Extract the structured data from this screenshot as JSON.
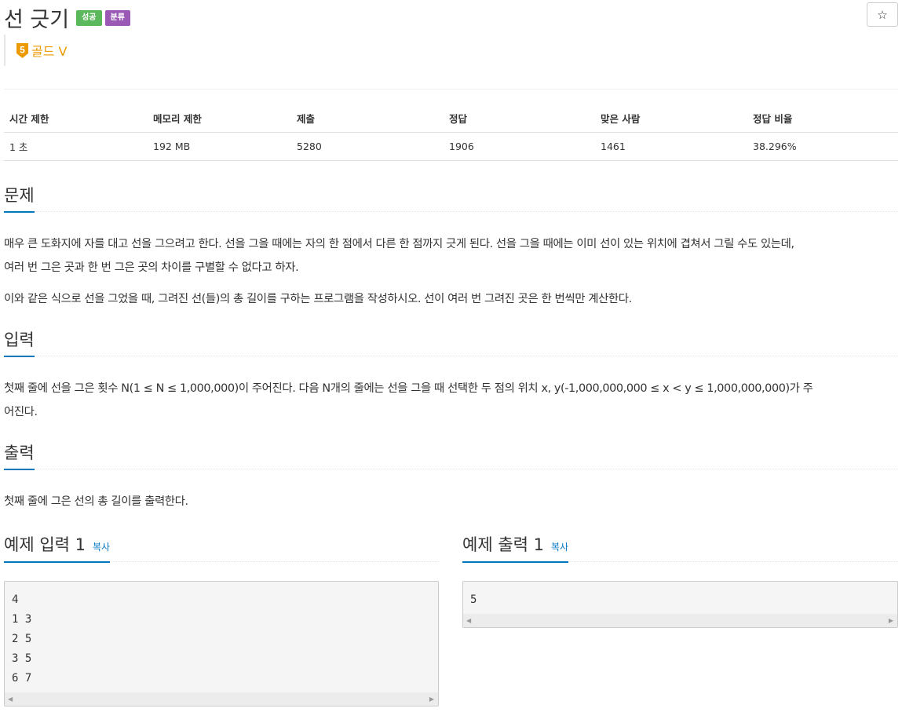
{
  "problem": {
    "title": "선 긋기",
    "badges": {
      "success": "성공",
      "category": "분류"
    },
    "tier": {
      "number": "5",
      "label": "골드 V"
    },
    "star_icon": "☆"
  },
  "info_table": {
    "headers": [
      "시간 제한",
      "메모리 제한",
      "제출",
      "정답",
      "맞은 사람",
      "정답 비율"
    ],
    "values": [
      "1 초",
      "192 MB",
      "5280",
      "1906",
      "1461",
      "38.296%"
    ]
  },
  "sections": {
    "problem": {
      "heading": "문제",
      "paragraphs": [
        "매우 큰 도화지에 자를 대고 선을 그으려고 한다. 선을 그을 때에는 자의 한 점에서 다른 한 점까지 긋게 된다. 선을 그을 때에는 이미 선이 있는 위치에 겹쳐서 그릴 수도 있는데,",
        "여러 번 그은 곳과 한 번 그은 곳의 차이를 구별할 수 없다고 하자.",
        "이와 같은 식으로 선을 그었을 때, 그려진 선(들)의 총 길이를 구하는 프로그램을 작성하시오. 선이 여러 번 그려진 곳은 한 번씩만 계산한다."
      ]
    },
    "input": {
      "heading": "입력",
      "paragraphs": [
        "첫째 줄에 선을 그은 횟수 N(1 ≤ N ≤ 1,000,000)이 주어진다. 다음 N개의 줄에는 선을 그을 때 선택한 두 점의 위치 x, y(-1,000,000,000 ≤ x < y ≤ 1,000,000,000)가 주",
        "어진다."
      ]
    },
    "output": {
      "heading": "출력",
      "paragraphs": [
        "첫째 줄에 그은 선의 총 길이를 출력한다."
      ]
    }
  },
  "samples": {
    "input": {
      "heading": "예제 입력 1",
      "copy": "복사",
      "content": "4\n1 3\n2 5\n3 5\n6 7"
    },
    "output": {
      "heading": "예제 출력 1",
      "copy": "복사",
      "content": "5"
    }
  },
  "colors": {
    "success": "#5cb85c",
    "category": "#9b59b6",
    "tier_gold": "#ec9a00",
    "accent_blue": "#0076c0"
  }
}
